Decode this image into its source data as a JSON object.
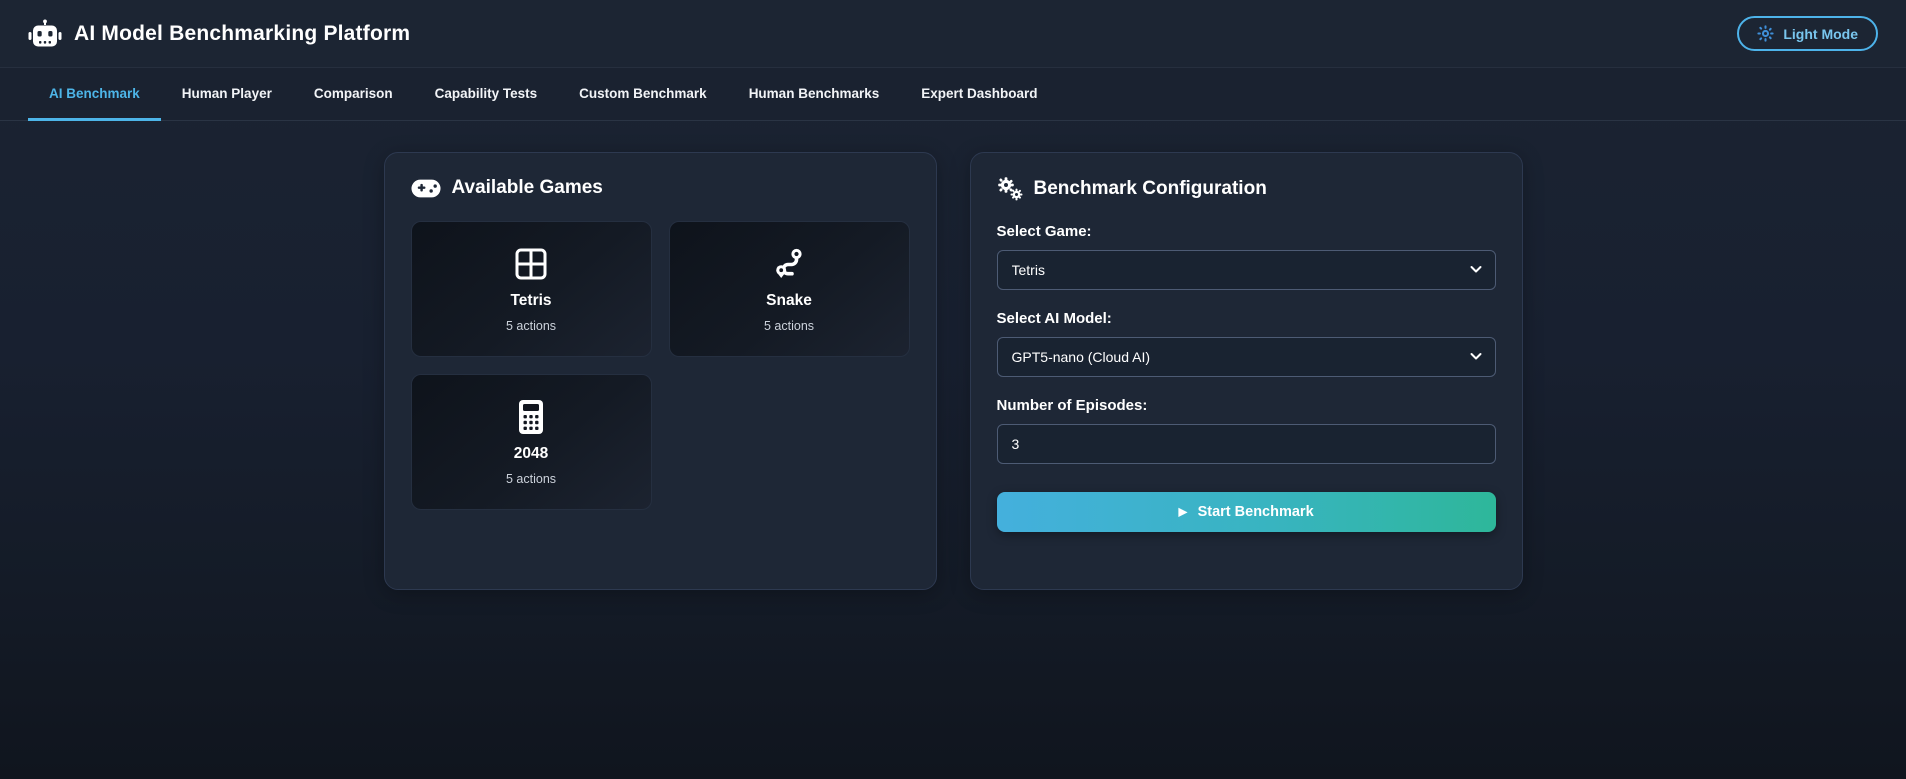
{
  "header": {
    "title": "AI Model Benchmarking Platform",
    "light_mode_label": "Light Mode"
  },
  "tabs": [
    {
      "label": "AI Benchmark",
      "active": true
    },
    {
      "label": "Human Player",
      "active": false
    },
    {
      "label": "Comparison",
      "active": false
    },
    {
      "label": "Capability Tests",
      "active": false
    },
    {
      "label": "Custom Benchmark",
      "active": false
    },
    {
      "label": "Human Benchmarks",
      "active": false
    },
    {
      "label": "Expert Dashboard",
      "active": false
    }
  ],
  "games_panel": {
    "title": "Available Games",
    "games": [
      {
        "name": "Tetris",
        "actions": "5 actions",
        "icon": "grid-icon"
      },
      {
        "name": "Snake",
        "actions": "5 actions",
        "icon": "route-icon"
      },
      {
        "name": "2048",
        "actions": "5 actions",
        "icon": "calculator-icon"
      }
    ]
  },
  "config_panel": {
    "title": "Benchmark Configuration",
    "game_label": "Select Game:",
    "game_value": "Tetris",
    "model_label": "Select AI Model:",
    "model_value": "GPT5-nano (Cloud AI)",
    "episodes_label": "Number of Episodes:",
    "episodes_value": "3",
    "start_label": "Start Benchmark",
    "play_glyph": "▶"
  },
  "colors": {
    "accent_blue": "#4db5e8",
    "button_gradient_start": "#44b0dd",
    "button_gradient_end": "#2eb79a",
    "panel_bg": "#1e2736",
    "page_bg_top": "#1b2432",
    "page_bg_bottom": "#10151e"
  }
}
